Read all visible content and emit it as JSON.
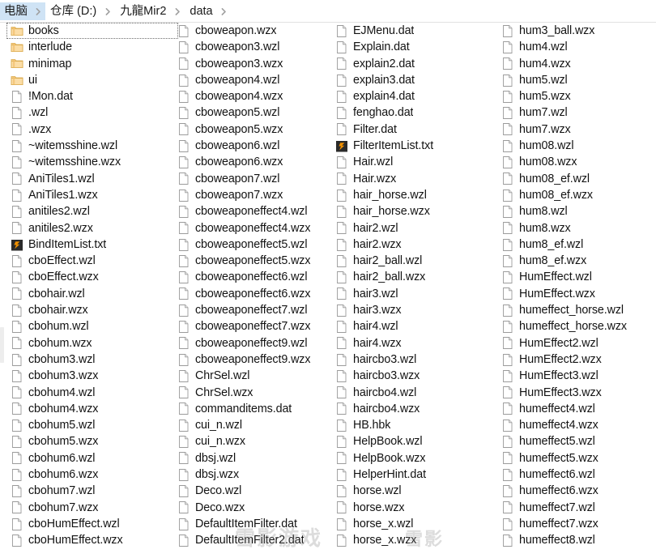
{
  "window": {
    "title": "data",
    "kind": "file-explorer"
  },
  "addressbar": {
    "crumbs": [
      {
        "label": "电脑",
        "highlighted": true
      },
      {
        "label": "仓库 (D:)",
        "highlighted": false
      },
      {
        "label": "九龍Mir2",
        "highlighted": false
      },
      {
        "label": "data",
        "highlighted": false
      }
    ],
    "separator_icon": "chevron-right-icon"
  },
  "colors": {
    "crumb_highlight": "#cfe3f5",
    "folder_icon": "#f5c96a",
    "folder_icon_dark": "#e0a93f",
    "file_icon_border": "#9b9b9b",
    "text": "#121212",
    "special_icon_bg": "#2b2b2b",
    "special_icon_fg": "#f09000",
    "splitter": "#ededed"
  },
  "filelist": {
    "view": "list",
    "focused_item": "books",
    "columns": [
      {
        "index": 0,
        "items": [
          {
            "name": "books",
            "icon": "folder-icon",
            "focused": true
          },
          {
            "name": "interlude",
            "icon": "folder-icon"
          },
          {
            "name": "minimap",
            "icon": "folder-icon"
          },
          {
            "name": "ui",
            "icon": "folder-icon"
          },
          {
            "name": "!Mon.dat",
            "icon": "file-icon"
          },
          {
            "name": ".wzl",
            "icon": "file-icon"
          },
          {
            "name": ".wzx",
            "icon": "file-icon"
          },
          {
            "name": "~witemsshine.wzl",
            "icon": "file-icon"
          },
          {
            "name": "~witemsshine.wzx",
            "icon": "file-icon"
          },
          {
            "name": "AniTiles1.wzl",
            "icon": "file-icon"
          },
          {
            "name": "AniTiles1.wzx",
            "icon": "file-icon"
          },
          {
            "name": "anitiles2.wzl",
            "icon": "file-icon"
          },
          {
            "name": "anitiles2.wzx",
            "icon": "file-icon"
          },
          {
            "name": "BindItemList.txt",
            "icon": "scite-text-icon"
          },
          {
            "name": "cboEffect.wzl",
            "icon": "file-icon"
          },
          {
            "name": "cboEffect.wzx",
            "icon": "file-icon"
          },
          {
            "name": "cbohair.wzl",
            "icon": "file-icon"
          },
          {
            "name": "cbohair.wzx",
            "icon": "file-icon"
          },
          {
            "name": "cbohum.wzl",
            "icon": "file-icon"
          },
          {
            "name": "cbohum.wzx",
            "icon": "file-icon"
          },
          {
            "name": "cbohum3.wzl",
            "icon": "file-icon"
          },
          {
            "name": "cbohum3.wzx",
            "icon": "file-icon"
          },
          {
            "name": "cbohum4.wzl",
            "icon": "file-icon"
          },
          {
            "name": "cbohum4.wzx",
            "icon": "file-icon"
          },
          {
            "name": "cbohum5.wzl",
            "icon": "file-icon"
          },
          {
            "name": "cbohum5.wzx",
            "icon": "file-icon"
          },
          {
            "name": "cbohum6.wzl",
            "icon": "file-icon"
          },
          {
            "name": "cbohum6.wzx",
            "icon": "file-icon"
          },
          {
            "name": "cbohum7.wzl",
            "icon": "file-icon"
          },
          {
            "name": "cbohum7.wzx",
            "icon": "file-icon"
          },
          {
            "name": "cboHumEffect.wzl",
            "icon": "file-icon"
          },
          {
            "name": "cboHumEffect.wzx",
            "icon": "file-icon"
          }
        ]
      },
      {
        "index": 1,
        "items": [
          {
            "name": "cboweapon.wzx",
            "icon": "file-icon"
          },
          {
            "name": "cboweapon3.wzl",
            "icon": "file-icon"
          },
          {
            "name": "cboweapon3.wzx",
            "icon": "file-icon"
          },
          {
            "name": "cboweapon4.wzl",
            "icon": "file-icon"
          },
          {
            "name": "cboweapon4.wzx",
            "icon": "file-icon"
          },
          {
            "name": "cboweapon5.wzl",
            "icon": "file-icon"
          },
          {
            "name": "cboweapon5.wzx",
            "icon": "file-icon"
          },
          {
            "name": "cboweapon6.wzl",
            "icon": "file-icon"
          },
          {
            "name": "cboweapon6.wzx",
            "icon": "file-icon"
          },
          {
            "name": "cboweapon7.wzl",
            "icon": "file-icon"
          },
          {
            "name": "cboweapon7.wzx",
            "icon": "file-icon"
          },
          {
            "name": "cboweaponeffect4.wzl",
            "icon": "file-icon"
          },
          {
            "name": "cboweaponeffect4.wzx",
            "icon": "file-icon"
          },
          {
            "name": "cboweaponeffect5.wzl",
            "icon": "file-icon"
          },
          {
            "name": "cboweaponeffect5.wzx",
            "icon": "file-icon"
          },
          {
            "name": "cboweaponeffect6.wzl",
            "icon": "file-icon"
          },
          {
            "name": "cboweaponeffect6.wzx",
            "icon": "file-icon"
          },
          {
            "name": "cboweaponeffect7.wzl",
            "icon": "file-icon"
          },
          {
            "name": "cboweaponeffect7.wzx",
            "icon": "file-icon"
          },
          {
            "name": "cboweaponeffect9.wzl",
            "icon": "file-icon"
          },
          {
            "name": "cboweaponeffect9.wzx",
            "icon": "file-icon"
          },
          {
            "name": "ChrSel.wzl",
            "icon": "file-icon"
          },
          {
            "name": "ChrSel.wzx",
            "icon": "file-icon"
          },
          {
            "name": "commanditems.dat",
            "icon": "file-icon"
          },
          {
            "name": "cui_n.wzl",
            "icon": "file-icon"
          },
          {
            "name": "cui_n.wzx",
            "icon": "file-icon"
          },
          {
            "name": "dbsj.wzl",
            "icon": "file-icon"
          },
          {
            "name": "dbsj.wzx",
            "icon": "file-icon"
          },
          {
            "name": "Deco.wzl",
            "icon": "file-icon"
          },
          {
            "name": "Deco.wzx",
            "icon": "file-icon"
          },
          {
            "name": "DefaultItemFilter.dat",
            "icon": "file-icon"
          },
          {
            "name": "DefaultItemFilter2.dat",
            "icon": "file-icon"
          }
        ]
      },
      {
        "index": 2,
        "items": [
          {
            "name": "EJMenu.dat",
            "icon": "file-icon"
          },
          {
            "name": "Explain.dat",
            "icon": "file-icon"
          },
          {
            "name": "explain2.dat",
            "icon": "file-icon"
          },
          {
            "name": "explain3.dat",
            "icon": "file-icon"
          },
          {
            "name": "explain4.dat",
            "icon": "file-icon"
          },
          {
            "name": "fenghao.dat",
            "icon": "file-icon"
          },
          {
            "name": "Filter.dat",
            "icon": "file-icon"
          },
          {
            "name": "FilterItemList.txt",
            "icon": "scite-text-icon"
          },
          {
            "name": "Hair.wzl",
            "icon": "file-icon"
          },
          {
            "name": "Hair.wzx",
            "icon": "file-icon"
          },
          {
            "name": "hair_horse.wzl",
            "icon": "file-icon"
          },
          {
            "name": "hair_horse.wzx",
            "icon": "file-icon"
          },
          {
            "name": "hair2.wzl",
            "icon": "file-icon"
          },
          {
            "name": "hair2.wzx",
            "icon": "file-icon"
          },
          {
            "name": "hair2_ball.wzl",
            "icon": "file-icon"
          },
          {
            "name": "hair2_ball.wzx",
            "icon": "file-icon"
          },
          {
            "name": "hair3.wzl",
            "icon": "file-icon"
          },
          {
            "name": "hair3.wzx",
            "icon": "file-icon"
          },
          {
            "name": "hair4.wzl",
            "icon": "file-icon"
          },
          {
            "name": "hair4.wzx",
            "icon": "file-icon"
          },
          {
            "name": "haircbo3.wzl",
            "icon": "file-icon"
          },
          {
            "name": "haircbo3.wzx",
            "icon": "file-icon"
          },
          {
            "name": "haircbo4.wzl",
            "icon": "file-icon"
          },
          {
            "name": "haircbo4.wzx",
            "icon": "file-icon"
          },
          {
            "name": "HB.hbk",
            "icon": "file-icon"
          },
          {
            "name": "HelpBook.wzl",
            "icon": "file-icon"
          },
          {
            "name": "HelpBook.wzx",
            "icon": "file-icon"
          },
          {
            "name": "HelperHint.dat",
            "icon": "file-icon"
          },
          {
            "name": "horse.wzl",
            "icon": "file-icon"
          },
          {
            "name": "horse.wzx",
            "icon": "file-icon"
          },
          {
            "name": "horse_x.wzl",
            "icon": "file-icon"
          },
          {
            "name": "horse_x.wzx",
            "icon": "file-icon"
          }
        ]
      },
      {
        "index": 3,
        "items": [
          {
            "name": "hum3_ball.wzx",
            "icon": "file-icon"
          },
          {
            "name": "hum4.wzl",
            "icon": "file-icon"
          },
          {
            "name": "hum4.wzx",
            "icon": "file-icon"
          },
          {
            "name": "hum5.wzl",
            "icon": "file-icon"
          },
          {
            "name": "hum5.wzx",
            "icon": "file-icon"
          },
          {
            "name": "hum7.wzl",
            "icon": "file-icon"
          },
          {
            "name": "hum7.wzx",
            "icon": "file-icon"
          },
          {
            "name": "hum08.wzl",
            "icon": "file-icon"
          },
          {
            "name": "hum08.wzx",
            "icon": "file-icon"
          },
          {
            "name": "hum08_ef.wzl",
            "icon": "file-icon"
          },
          {
            "name": "hum08_ef.wzx",
            "icon": "file-icon"
          },
          {
            "name": "hum8.wzl",
            "icon": "file-icon"
          },
          {
            "name": "hum8.wzx",
            "icon": "file-icon"
          },
          {
            "name": "hum8_ef.wzl",
            "icon": "file-icon"
          },
          {
            "name": "hum8_ef.wzx",
            "icon": "file-icon"
          },
          {
            "name": "HumEffect.wzl",
            "icon": "file-icon"
          },
          {
            "name": "HumEffect.wzx",
            "icon": "file-icon"
          },
          {
            "name": "humeffect_horse.wzl",
            "icon": "file-icon"
          },
          {
            "name": "humeffect_horse.wzx",
            "icon": "file-icon"
          },
          {
            "name": "HumEffect2.wzl",
            "icon": "file-icon"
          },
          {
            "name": "HumEffect2.wzx",
            "icon": "file-icon"
          },
          {
            "name": "HumEffect3.wzl",
            "icon": "file-icon"
          },
          {
            "name": "HumEffect3.wzx",
            "icon": "file-icon"
          },
          {
            "name": "humeffect4.wzl",
            "icon": "file-icon"
          },
          {
            "name": "humeffect4.wzx",
            "icon": "file-icon"
          },
          {
            "name": "humeffect5.wzl",
            "icon": "file-icon"
          },
          {
            "name": "humeffect5.wzx",
            "icon": "file-icon"
          },
          {
            "name": "humeffect6.wzl",
            "icon": "file-icon"
          },
          {
            "name": "humeffect6.wzx",
            "icon": "file-icon"
          },
          {
            "name": "humeffect7.wzl",
            "icon": "file-icon"
          },
          {
            "name": "humeffect7.wzx",
            "icon": "file-icon"
          },
          {
            "name": "humeffect8.wzl",
            "icon": "file-icon"
          }
        ]
      }
    ]
  },
  "watermarks": [
    {
      "text": "雪影游戏",
      "id": "wm1"
    },
    {
      "text": "雪影",
      "id": "wm2"
    }
  ]
}
